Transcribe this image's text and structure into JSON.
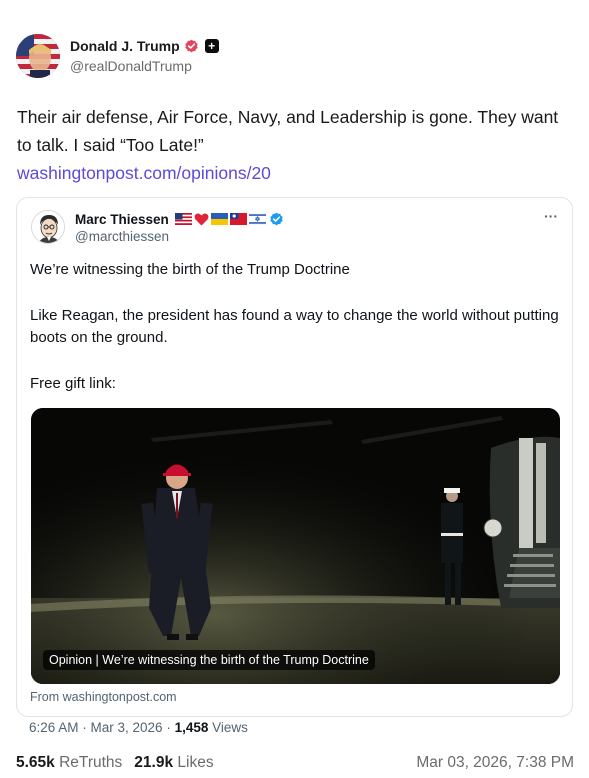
{
  "post": {
    "author_name": "Donald J. Trump",
    "author_handle": "@realDonaldTrump",
    "text": "Their air defense, Air Force, Navy, and Leadership is gone. They want to talk. I said “Too Late!”",
    "link": "washingtonpost.com/opinions/20"
  },
  "quote": {
    "author_name": "Marc Thiessen",
    "author_handle": "@marcthiessen",
    "emojis": [
      "us-flag-icon",
      "red-heart-icon",
      "ukraine-flag-icon",
      "taiwan-flag-icon",
      "israel-flag-icon"
    ],
    "more_label": "···",
    "paragraph_1": "We’re witnessing the birth of the Trump Doctrine",
    "paragraph_2": "Like Reagan, the president has found a way to change the world without putting boots on the ground.",
    "paragraph_3": "Free gift link:",
    "media_caption": "Opinion | We’re witnessing the birth of the Trump Doctrine",
    "source": "From washingtonpost.com",
    "timestamp": "6:26 AM · Mar 3, 2026 · ",
    "views_count": "1,458",
    "views_label": " Views"
  },
  "stats": {
    "retruths_count": "5.65k",
    "retruths_label": "ReTruths",
    "likes_count": "21.9k",
    "likes_label": "Likes",
    "date": "Mar 03, 2026, 7:38 PM"
  },
  "colors": {
    "link": "#5b4bd8",
    "verified_badge": "#e0465f",
    "x_verified": "#1d9bf0"
  }
}
